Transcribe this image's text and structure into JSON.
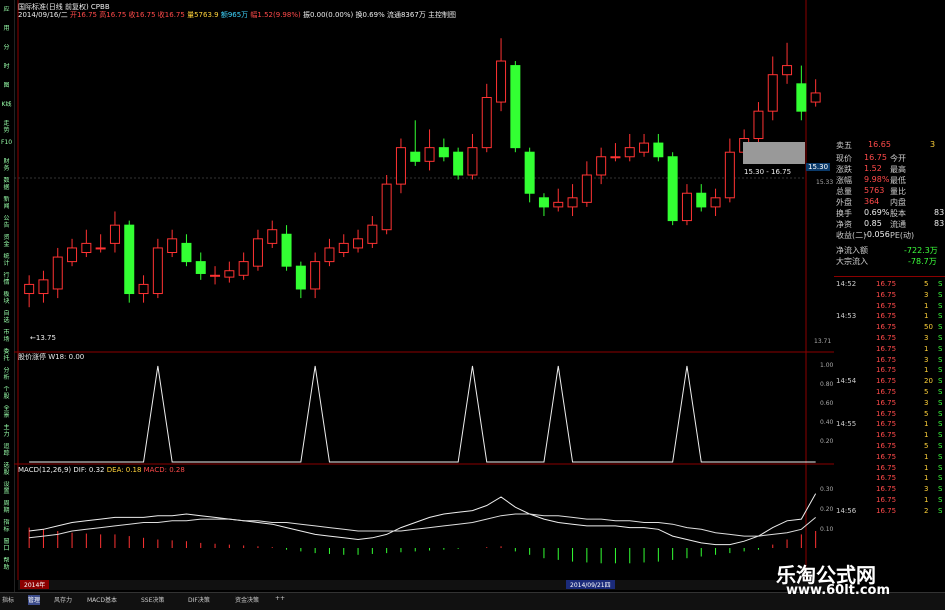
{
  "header": {
    "line1": "国际标准(日线 前复权) CPBB",
    "date": "2014/09/16/二",
    "open_label": "开",
    "open": "16.75",
    "high_label": "高",
    "high": "16.75",
    "low_label": "收",
    "low": "16.75",
    "close_label": "收",
    "close": "16.75",
    "vol_label": "量",
    "vol": "5763.9",
    "amt_label": "额",
    "amt": "965万",
    "chg_label": "幅",
    "chg": "1.52(9.98%)",
    "misc": "振0.00(0.00%)",
    "turn": "换0.69%",
    "float": "流通8367万",
    "extra": "主控制图"
  },
  "price_labels": {
    "max_tag": "15.30",
    "max_side": "15.33",
    "min_tag": "←13.75",
    "range_box": "15.30 - 16.75",
    "bottom_axis": "13.71"
  },
  "indicator1": {
    "label": "股价涨停 W18: 0.00",
    "axis": [
      "1.00",
      "0.80",
      "0.60",
      "0.40",
      "0.20"
    ]
  },
  "macd": {
    "label_name": "MACD(12,26,9)",
    "dif": "DIF: 0.32",
    "dea": "DEA: 0.18",
    "macd": "MACD: 0.28",
    "axis": [
      "0.30",
      "0.20",
      "0.10"
    ]
  },
  "bottom_bar": {
    "date_left": "2014年",
    "date_mid": "2014/09/21四",
    "tabs": [
      "指标",
      "管理",
      "风存力",
      "MACD基本",
      "SSE决策",
      "DIF决策",
      "资金决策",
      "++"
    ],
    "bottom_row": [
      "主周期",
      "X 系列",
      "公式工具",
      "多日画线",
      "分析周期",
      "经典指标",
      "公式管理",
      "选股公式",
      "板块",
      "主图"
    ]
  },
  "left_tabs": [
    "应",
    "用",
    "分",
    "时",
    "图",
    "K线",
    "走势",
    "F10",
    "财务",
    "数据",
    "新闻",
    "公告",
    "资金",
    "统计",
    "行情",
    "板块",
    "自选",
    "市场",
    "委托",
    "分析",
    "个股",
    "全景",
    "主力",
    "追踪",
    "选股",
    "设置",
    "周期",
    "指标",
    "窗口",
    "帮助"
  ],
  "quote_panel": {
    "ask5": {
      "label": "卖五",
      "price": "16.65",
      "vol": "3"
    },
    "rows": [
      {
        "l": "现价",
        "v": "16.75",
        "l2": "今开",
        "v2": ""
      },
      {
        "l": "涨跌",
        "v": "1.52",
        "l2": "最高",
        "v2": ""
      },
      {
        "l": "涨幅",
        "v": "9.98%",
        "l2": "最低",
        "v2": ""
      },
      {
        "l": "总量",
        "v": "5763",
        "l2": "量比",
        "v2": ""
      },
      {
        "l": "外盘",
        "v": "364",
        "l2": "内盘",
        "v2": ""
      },
      {
        "l": "换手",
        "v": "0.69%",
        "l2": "股本",
        "v2": "83"
      },
      {
        "l": "净资",
        "v": "0.85",
        "l2": "流通",
        "v2": "83"
      },
      {
        "l": "收益(二)",
        "v": "-0.056",
        "l2": "PE(动)",
        "v2": ""
      }
    ],
    "flow_in": {
      "label": "净流入额",
      "v": "-722.3万"
    },
    "big_in": {
      "label": "大宗流入",
      "v": "-78.7万"
    },
    "ticks": [
      {
        "t": "14:52",
        "p": "16.75",
        "v": "5",
        "s": "S"
      },
      {
        "t": "",
        "p": "16.75",
        "v": "3",
        "s": "S"
      },
      {
        "t": "",
        "p": "16.75",
        "v": "1",
        "s": "S"
      },
      {
        "t": "14:53",
        "p": "16.75",
        "v": "1",
        "s": "S"
      },
      {
        "t": "",
        "p": "16.75",
        "v": "50",
        "s": "S"
      },
      {
        "t": "",
        "p": "16.75",
        "v": "3",
        "s": "S"
      },
      {
        "t": "",
        "p": "16.75",
        "v": "1",
        "s": "S"
      },
      {
        "t": "",
        "p": "16.75",
        "v": "3",
        "s": "S"
      },
      {
        "t": "",
        "p": "16.75",
        "v": "1",
        "s": "S"
      },
      {
        "t": "14:54",
        "p": "16.75",
        "v": "20",
        "s": "S"
      },
      {
        "t": "",
        "p": "16.75",
        "v": "5",
        "s": "S"
      },
      {
        "t": "",
        "p": "16.75",
        "v": "3",
        "s": "S"
      },
      {
        "t": "",
        "p": "16.75",
        "v": "5",
        "s": "S"
      },
      {
        "t": "14:55",
        "p": "16.75",
        "v": "1",
        "s": "S"
      },
      {
        "t": "",
        "p": "16.75",
        "v": "1",
        "s": "S"
      },
      {
        "t": "",
        "p": "16.75",
        "v": "5",
        "s": "S"
      },
      {
        "t": "",
        "p": "16.75",
        "v": "1",
        "s": "S"
      },
      {
        "t": "",
        "p": "16.75",
        "v": "1",
        "s": "S"
      },
      {
        "t": "",
        "p": "16.75",
        "v": "1",
        "s": "S"
      },
      {
        "t": "",
        "p": "16.75",
        "v": "3",
        "s": "S"
      },
      {
        "t": "",
        "p": "16.75",
        "v": "1",
        "s": "S"
      },
      {
        "t": "14:56",
        "p": "16.75",
        "v": "2",
        "s": "S"
      }
    ]
  },
  "watermark": {
    "cn": "乐淘公式网",
    "url": "www.60lt.com"
  },
  "colors": {
    "up": "#ff3333",
    "down": "#33ff33",
    "bg": "#000000",
    "grid": "#8b0000"
  },
  "candles": [
    {
      "o": 14.0,
      "c": 14.1,
      "h": 14.2,
      "l": 13.85
    },
    {
      "o": 14.0,
      "c": 14.15,
      "h": 14.25,
      "l": 13.9
    },
    {
      "o": 14.05,
      "c": 14.4,
      "h": 14.5,
      "l": 13.95
    },
    {
      "o": 14.35,
      "c": 14.5,
      "h": 14.6,
      "l": 14.3
    },
    {
      "o": 14.45,
      "c": 14.55,
      "h": 14.7,
      "l": 14.4
    },
    {
      "o": 14.5,
      "c": 14.5,
      "h": 14.65,
      "l": 14.45
    },
    {
      "o": 14.55,
      "c": 14.75,
      "h": 14.9,
      "l": 14.45
    },
    {
      "o": 14.75,
      "c": 14.0,
      "h": 14.8,
      "l": 13.9
    },
    {
      "o": 14.0,
      "c": 14.1,
      "h": 14.2,
      "l": 13.9
    },
    {
      "o": 14.0,
      "c": 14.5,
      "h": 14.6,
      "l": 13.95
    },
    {
      "o": 14.45,
      "c": 14.6,
      "h": 14.7,
      "l": 14.4
    },
    {
      "o": 14.55,
      "c": 14.35,
      "h": 14.65,
      "l": 14.3
    },
    {
      "o": 14.35,
      "c": 14.22,
      "h": 14.45,
      "l": 14.15
    },
    {
      "o": 14.2,
      "c": 14.2,
      "h": 14.3,
      "l": 14.1
    },
    {
      "o": 14.18,
      "c": 14.25,
      "h": 14.35,
      "l": 14.12
    },
    {
      "o": 14.2,
      "c": 14.35,
      "h": 14.45,
      "l": 14.15
    },
    {
      "o": 14.3,
      "c": 14.6,
      "h": 14.7,
      "l": 14.25
    },
    {
      "o": 14.55,
      "c": 14.7,
      "h": 14.8,
      "l": 14.5
    },
    {
      "o": 14.65,
      "c": 14.3,
      "h": 14.75,
      "l": 14.25
    },
    {
      "o": 14.3,
      "c": 14.05,
      "h": 14.35,
      "l": 13.95
    },
    {
      "o": 14.05,
      "c": 14.35,
      "h": 14.45,
      "l": 13.95
    },
    {
      "o": 14.35,
      "c": 14.5,
      "h": 14.6,
      "l": 14.3
    },
    {
      "o": 14.45,
      "c": 14.55,
      "h": 14.65,
      "l": 14.4
    },
    {
      "o": 14.5,
      "c": 14.6,
      "h": 14.7,
      "l": 14.45
    },
    {
      "o": 14.55,
      "c": 14.75,
      "h": 14.85,
      "l": 14.5
    },
    {
      "o": 14.7,
      "c": 15.2,
      "h": 15.3,
      "l": 14.65
    },
    {
      "o": 15.2,
      "c": 15.6,
      "h": 15.7,
      "l": 15.1
    },
    {
      "o": 15.55,
      "c": 15.45,
      "h": 15.9,
      "l": 15.4
    },
    {
      "o": 15.45,
      "c": 15.6,
      "h": 15.8,
      "l": 15.35
    },
    {
      "o": 15.6,
      "c": 15.5,
      "h": 15.7,
      "l": 15.45
    },
    {
      "o": 15.55,
      "c": 15.3,
      "h": 15.6,
      "l": 15.25
    },
    {
      "o": 15.3,
      "c": 15.6,
      "h": 15.75,
      "l": 15.25
    },
    {
      "o": 15.6,
      "c": 16.15,
      "h": 16.3,
      "l": 15.55
    },
    {
      "o": 16.1,
      "c": 16.55,
      "h": 16.8,
      "l": 16.0
    },
    {
      "o": 16.5,
      "c": 15.6,
      "h": 16.55,
      "l": 15.55
    },
    {
      "o": 15.55,
      "c": 15.1,
      "h": 15.6,
      "l": 15.0
    },
    {
      "o": 15.05,
      "c": 14.95,
      "h": 15.1,
      "l": 14.85
    },
    {
      "o": 14.95,
      "c": 15.0,
      "h": 15.15,
      "l": 14.9
    },
    {
      "o": 14.95,
      "c": 15.05,
      "h": 15.2,
      "l": 14.85
    },
    {
      "o": 15.0,
      "c": 15.3,
      "h": 15.45,
      "l": 14.95
    },
    {
      "o": 15.3,
      "c": 15.5,
      "h": 15.6,
      "l": 15.2
    },
    {
      "o": 15.5,
      "c": 15.5,
      "h": 15.65,
      "l": 15.45
    },
    {
      "o": 15.5,
      "c": 15.6,
      "h": 15.75,
      "l": 15.45
    },
    {
      "o": 15.55,
      "c": 15.65,
      "h": 15.75,
      "l": 15.5
    },
    {
      "o": 15.65,
      "c": 15.5,
      "h": 15.75,
      "l": 15.45
    },
    {
      "o": 15.5,
      "c": 14.8,
      "h": 15.55,
      "l": 14.75
    },
    {
      "o": 14.8,
      "c": 15.1,
      "h": 15.2,
      "l": 14.75
    },
    {
      "o": 15.1,
      "c": 14.95,
      "h": 15.2,
      "l": 14.9
    },
    {
      "o": 14.95,
      "c": 15.05,
      "h": 15.15,
      "l": 14.85
    },
    {
      "o": 15.05,
      "c": 15.55,
      "h": 15.7,
      "l": 15.0
    },
    {
      "o": 15.55,
      "c": 15.7,
      "h": 15.8,
      "l": 15.5
    },
    {
      "o": 15.7,
      "c": 16.0,
      "h": 16.1,
      "l": 15.65
    },
    {
      "o": 16.0,
      "c": 16.4,
      "h": 16.6,
      "l": 15.9
    },
    {
      "o": 16.4,
      "c": 16.5,
      "h": 16.75,
      "l": 16.3
    },
    {
      "o": 16.3,
      "c": 16.0,
      "h": 16.5,
      "l": 15.9
    },
    {
      "o": 16.1,
      "c": 16.2,
      "h": 16.35,
      "l": 16.05
    }
  ],
  "spikes": [
    9,
    20,
    31,
    37,
    46
  ],
  "macd_hist": [
    0.12,
    0.11,
    0.1,
    0.09,
    0.085,
    0.08,
    0.08,
    0.07,
    0.06,
    0.05,
    0.045,
    0.04,
    0.03,
    0.025,
    0.02,
    0.015,
    0.01,
    0.005,
    -0.01,
    -0.02,
    -0.03,
    -0.035,
    -0.04,
    -0.04,
    -0.035,
    -0.03,
    -0.025,
    -0.02,
    -0.015,
    -0.01,
    -0.005,
    0.0,
    0.005,
    0.01,
    -0.02,
    -0.04,
    -0.06,
    -0.07,
    -0.08,
    -0.085,
    -0.09,
    -0.09,
    -0.09,
    -0.085,
    -0.08,
    -0.07,
    -0.06,
    -0.05,
    -0.04,
    -0.03,
    -0.02,
    -0.01,
    0.02,
    0.05,
    0.08,
    0.1
  ],
  "macd_dif": [
    0.1,
    0.11,
    0.13,
    0.15,
    0.16,
    0.17,
    0.18,
    0.18,
    0.18,
    0.19,
    0.19,
    0.2,
    0.19,
    0.18,
    0.17,
    0.16,
    0.15,
    0.14,
    0.12,
    0.1,
    0.08,
    0.07,
    0.06,
    0.05,
    0.06,
    0.08,
    0.12,
    0.15,
    0.18,
    0.2,
    0.21,
    0.22,
    0.25,
    0.3,
    0.24,
    0.2,
    0.17,
    0.15,
    0.14,
    0.13,
    0.13,
    0.13,
    0.12,
    0.12,
    0.11,
    0.07,
    0.05,
    0.03,
    0.02,
    0.02,
    0.04,
    0.07,
    0.12,
    0.16,
    0.17,
    0.32
  ],
  "macd_dea": [
    0.06,
    0.07,
    0.08,
    0.1,
    0.11,
    0.12,
    0.13,
    0.14,
    0.15,
    0.15,
    0.16,
    0.16,
    0.17,
    0.17,
    0.17,
    0.16,
    0.16,
    0.15,
    0.15,
    0.14,
    0.13,
    0.12,
    0.11,
    0.1,
    0.1,
    0.1,
    0.1,
    0.11,
    0.12,
    0.13,
    0.14,
    0.15,
    0.17,
    0.19,
    0.2,
    0.2,
    0.19,
    0.19,
    0.18,
    0.17,
    0.17,
    0.16,
    0.16,
    0.15,
    0.15,
    0.14,
    0.12,
    0.11,
    0.09,
    0.08,
    0.07,
    0.07,
    0.08,
    0.09,
    0.11,
    0.18
  ]
}
